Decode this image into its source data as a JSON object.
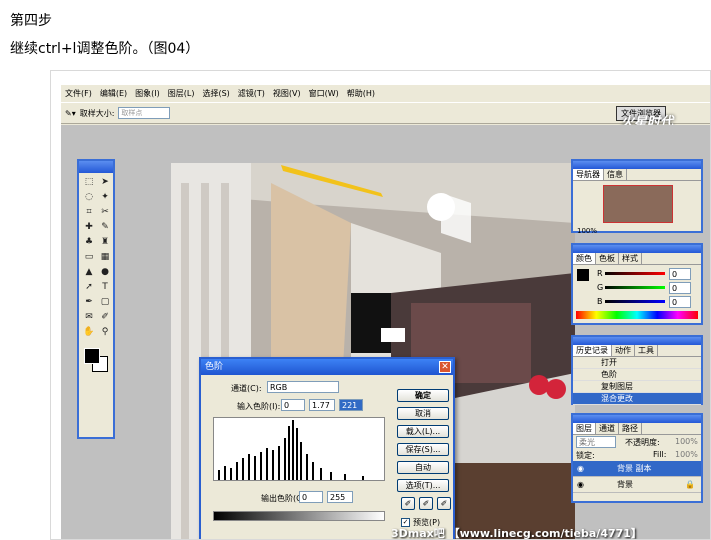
{
  "article": {
    "step_title": "第四步",
    "instruction": "继续ctrl+l调整色阶。（图04）"
  },
  "menubar": [
    "文件(F)",
    "编辑(E)",
    "图象(I)",
    "图层(L)",
    "选择(S)",
    "滤镜(T)",
    "视图(V)",
    "窗口(W)",
    "帮助(H)"
  ],
  "options": {
    "sample_label": "取样大小:",
    "sample_value": "取样点",
    "file_browser": "文件浏览器"
  },
  "logo_text": "火星时代",
  "navigator": {
    "tabs": [
      "导航器",
      "信息"
    ],
    "zoom": "100%"
  },
  "color": {
    "tabs": [
      "颜色",
      "色板",
      "样式"
    ],
    "channels": [
      "R",
      "G",
      "B"
    ],
    "values": [
      "0",
      "0",
      "0"
    ]
  },
  "history": {
    "tabs": [
      "历史记录",
      "动作",
      "工具"
    ],
    "items": [
      "打开",
      "色阶",
      "复制图层",
      "混合更改"
    ]
  },
  "layers": {
    "tabs": [
      "图层",
      "通道",
      "路径"
    ],
    "blend_mode": "柔光",
    "opacity_label": "不透明度:",
    "opacity_value": "100%",
    "lock_label": "锁定:",
    "fill_label": "Fill:",
    "fill_value": "100%",
    "items": [
      "背景 副本",
      "背景"
    ]
  },
  "levels_dialog": {
    "title": "色阶",
    "channel_label": "通道(C):",
    "channel_value": "RGB",
    "input_label": "输入色阶(I):",
    "input_values": [
      "0",
      "1.77",
      "221"
    ],
    "output_label": "输出色阶(O):",
    "output_values": [
      "0",
      "255"
    ],
    "buttons": [
      "确定",
      "取消",
      "载入(L)...",
      "保存(S)...",
      "自动",
      "选项(T)..."
    ],
    "preview_label": "预览(P)",
    "preview_checked": true
  },
  "watermark": "3Dmax吧 【www.linecg.com/tieba/4771】"
}
